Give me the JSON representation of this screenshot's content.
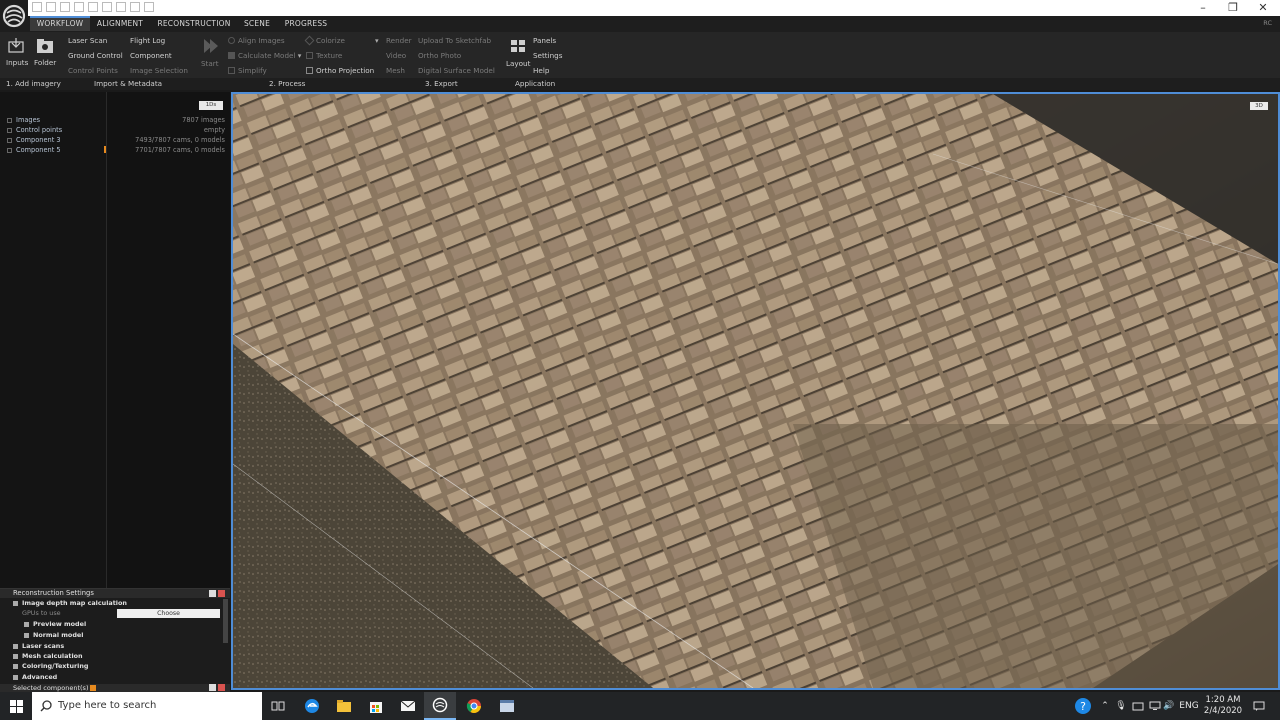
{
  "titlebar": {
    "controls": {
      "minimize": "–",
      "maximize": "❐",
      "close": "✕"
    },
    "accent": "#ea3d8a"
  },
  "menu": {
    "tabs": [
      {
        "label": "WORKFLOW",
        "active": true
      },
      {
        "label": "ALIGNMENT",
        "active": false
      },
      {
        "label": "RECONSTRUCTION",
        "active": false
      },
      {
        "label": "SCENE",
        "active": false
      },
      {
        "label": "PROGRESS",
        "active": false
      }
    ],
    "user": "RC"
  },
  "ribbon": {
    "add_imagery": {
      "inputs": "Inputs",
      "folder": "Folder",
      "group": "1. Add imagery"
    },
    "import_metadata": {
      "items": [
        "Laser Scan",
        "Ground Control",
        "Control Points",
        "Flight Log",
        "Component",
        "Image Selection"
      ],
      "group": "Import & Metadata"
    },
    "process": {
      "start": "Start",
      "items": [
        "Align Images",
        "Calculate Model",
        "Simplify",
        "Colorize",
        "Texture",
        "Ortho Projection"
      ],
      "group": "2. Process"
    },
    "export": {
      "items": [
        "Render",
        "Video",
        "Mesh",
        "Upload To Sketchfab",
        "Ortho Photo",
        "Digital Surface Model"
      ],
      "group": "3. Export"
    },
    "application": {
      "layout": "Layout",
      "items": [
        "Panels",
        "Settings",
        "Help"
      ],
      "group": "Application"
    }
  },
  "scene_tree": {
    "badge": "1Ds",
    "rows": [
      {
        "name": "Images",
        "value": "7807 images"
      },
      {
        "name": "Control points",
        "value": "empty"
      },
      {
        "name": "Component 3",
        "value": "7493/7807 cams, 0 models"
      },
      {
        "name": "Component 5",
        "value": "7701/7807 cams, 0 models"
      }
    ]
  },
  "viewport": {
    "badge": "3D",
    "accent": "#4f8dd6"
  },
  "settings": {
    "title": "Reconstruction Settings",
    "rows": [
      {
        "label": "Image depth map calculation",
        "level": 0
      },
      {
        "label": "GPUs to use",
        "level": 1,
        "sub": true
      },
      {
        "label": "Preview model",
        "level": 1
      },
      {
        "label": "Normal model",
        "level": 1
      },
      {
        "label": "Laser scans",
        "level": 0
      },
      {
        "label": "Mesh calculation",
        "level": 0
      },
      {
        "label": "Coloring/Texturing",
        "level": 0
      },
      {
        "label": "Advanced",
        "level": 0
      }
    ],
    "choose": "Choose",
    "selected_components": "Selected component(s)"
  },
  "taskbar": {
    "search_placeholder": "Type here to search",
    "lang": "ENG",
    "time": "1:20 AM",
    "date": "2/4/2020"
  }
}
